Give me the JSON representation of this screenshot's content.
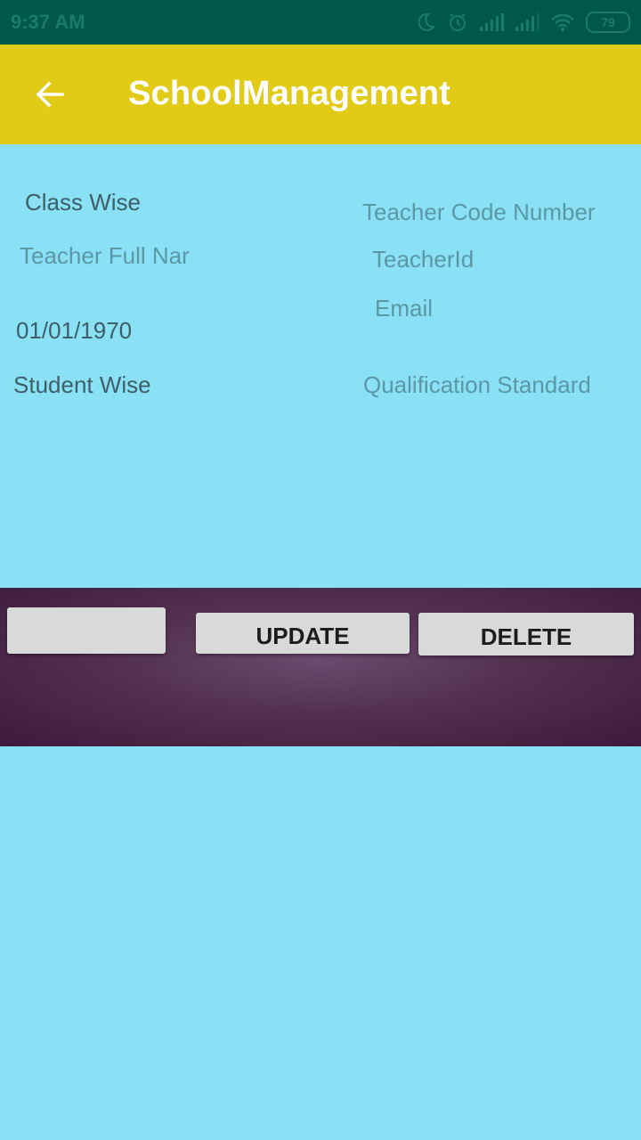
{
  "status_bar": {
    "time": "9:37 AM",
    "battery": "79",
    "icons": [
      "moon-icon",
      "alarm-icon",
      "signal-icon",
      "signal-icon",
      "wifi-icon"
    ]
  },
  "app_bar": {
    "title": "SchoolManagement",
    "back_icon": "arrow-left-icon"
  },
  "form": {
    "class_wise": "Class Wise",
    "teacher_full_name_placeholder": "Teacher Full Nar",
    "date": "01/01/1970",
    "student_wise": "Student Wise",
    "teacher_code_placeholder": "Teacher Code Number",
    "teacher_id_placeholder": "TeacherId",
    "email_placeholder": "Email",
    "qualification_placeholder": "Qualification Standard"
  },
  "actions": {
    "blank_label": "",
    "update_label": "UPDATE",
    "delete_label": "DELETE"
  },
  "colors": {
    "status_bar": "#00574b",
    "app_bar": "#e2cb16",
    "background": "#8ae0f4",
    "panel": "#53304f"
  }
}
